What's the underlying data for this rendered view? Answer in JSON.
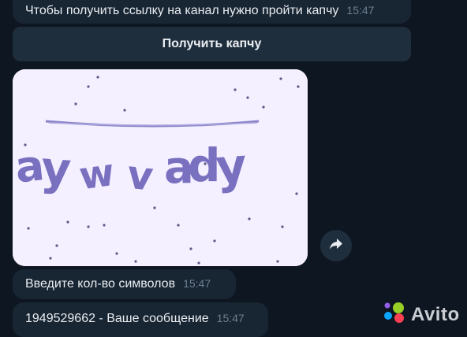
{
  "messages": [
    {
      "text": "Чтобы получить ссылку на канал нужно пройти капчу",
      "time": "15:47"
    },
    {
      "text": "Введите кол-во символов",
      "time": "15:47"
    },
    {
      "text": "1949529662 - Ваше сообщение",
      "time": "15:47"
    }
  ],
  "captcha_button": {
    "label": "Получить капчу"
  },
  "captcha_image": {
    "chars": [
      "a",
      "y",
      "w",
      "v",
      "a",
      "d",
      "y"
    ]
  },
  "forward_icon": "forward-arrow-icon",
  "watermark": {
    "text": "Avito",
    "colors": [
      "#97cf26",
      "#0aa5ff",
      "#ff4053",
      "#965eeb"
    ]
  },
  "colors": {
    "background": "#0e1621",
    "bubble": "#182533",
    "time": "#6d7f8f"
  }
}
